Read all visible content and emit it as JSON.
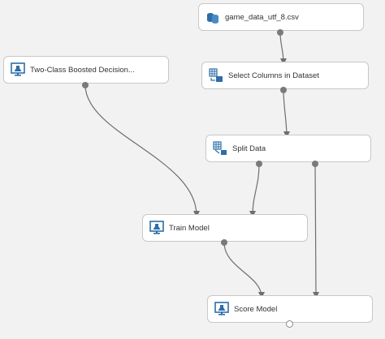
{
  "nodes": {
    "dataset": {
      "label": "game_data_utf_8.csv",
      "icon": "dataset-icon"
    },
    "boosted": {
      "label": "Two-Class Boosted Decision...",
      "icon": "flask-icon"
    },
    "select_columns": {
      "label": "Select Columns in Dataset",
      "icon": "table-transform-icon"
    },
    "split": {
      "label": "Split Data",
      "icon": "table-split-icon"
    },
    "train": {
      "label": "Train Model",
      "icon": "model-monitor-icon"
    },
    "score": {
      "label": "Score Model",
      "icon": "model-monitor-icon"
    }
  },
  "colors": {
    "canvas": "#f2f2f2",
    "node_bg": "#ffffff",
    "node_border": "#c8c8c8",
    "icon_blue": "#2d6ea8",
    "edge": "#6e6e6e"
  }
}
